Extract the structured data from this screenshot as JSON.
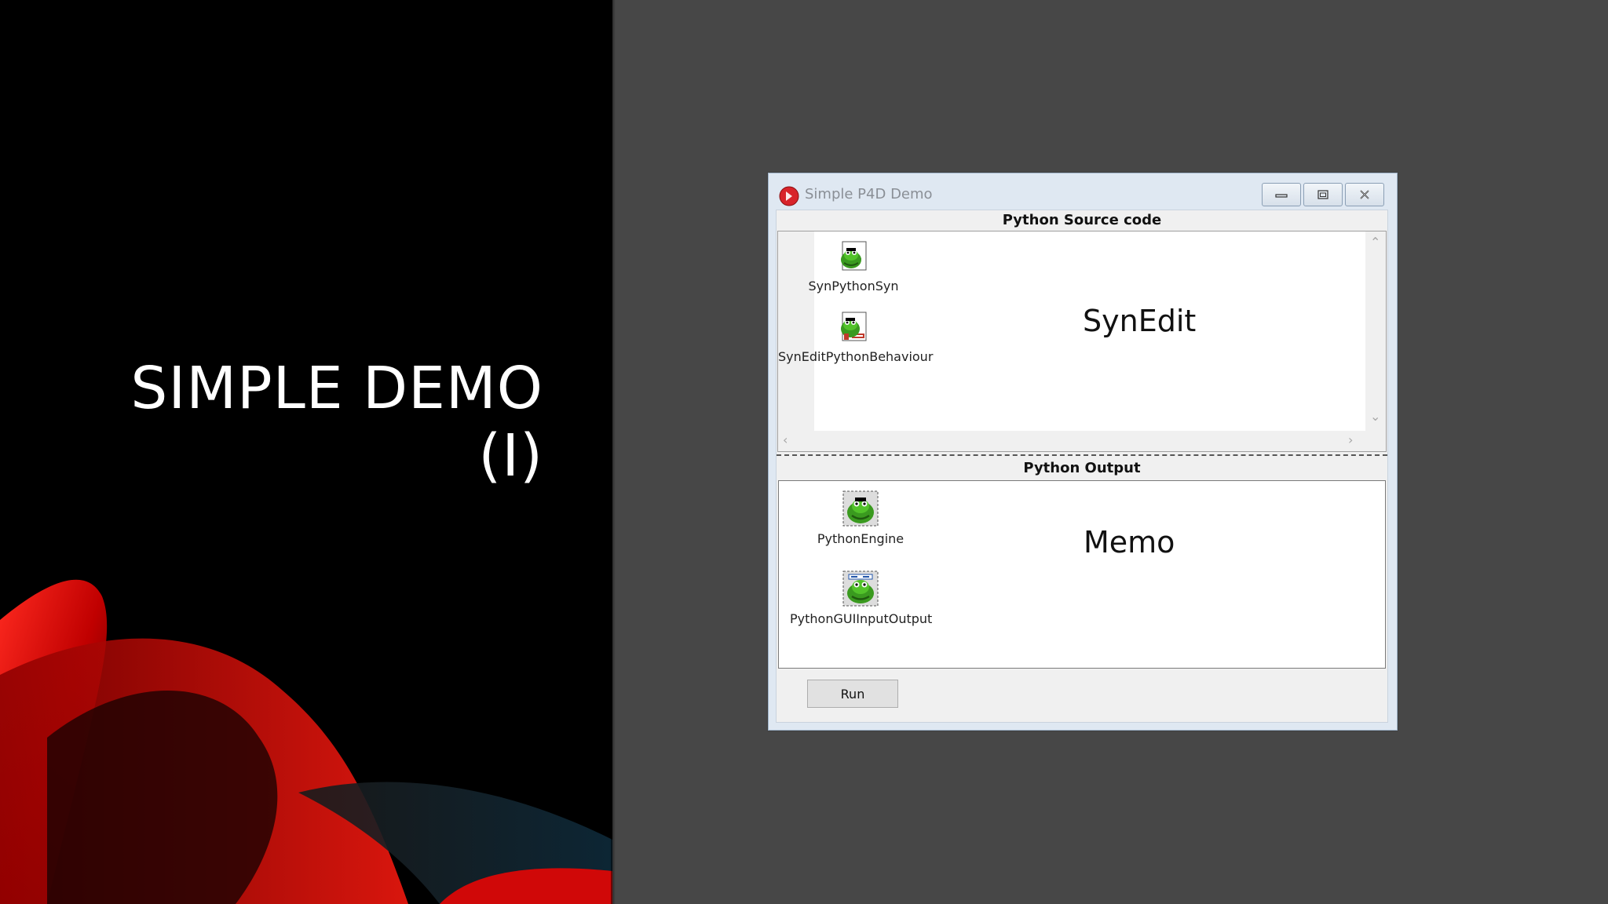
{
  "slide": {
    "title_line1": "SIMPLE DEMO",
    "title_line2": "(I)"
  },
  "window": {
    "title": "Simple P4D Demo",
    "buttons": [
      "minimize-icon",
      "maximize-icon",
      "close-icon"
    ]
  },
  "source_panel": {
    "label": "Python Source code",
    "control_label": "SynEdit",
    "components": [
      {
        "name": "SynPythonSyn",
        "icon": "python-syntax-icon"
      },
      {
        "name": "SynEditPythonBehaviour",
        "icon": "python-behaviour-icon"
      }
    ]
  },
  "output_panel": {
    "label": "Python Output",
    "control_label": "Memo",
    "components": [
      {
        "name": "PythonEngine",
        "icon": "python-engine-icon"
      },
      {
        "name": "PythonGUIInputOutput",
        "icon": "python-io-icon"
      }
    ]
  },
  "run_button": {
    "label": "Run"
  },
  "colors": {
    "desktop": "#474747",
    "slide_bg": "#000000",
    "accent_red": "#d10a0a"
  }
}
